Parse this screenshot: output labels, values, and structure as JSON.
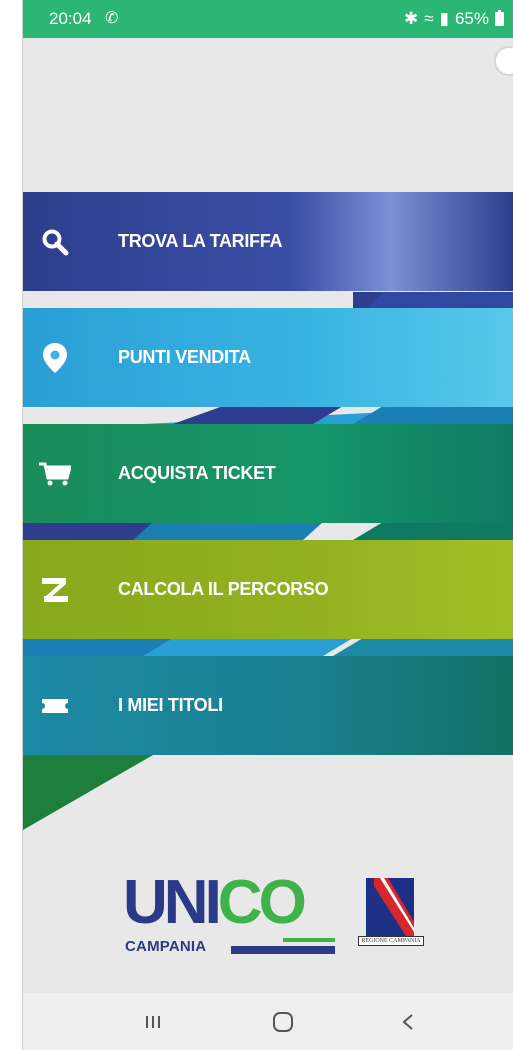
{
  "status_bar": {
    "time": "20:04",
    "call_icon": "call-icon",
    "signal_text": "65%",
    "bg_color": "#2bb673"
  },
  "menu": {
    "items": [
      {
        "label": "TROVA LA TARIFFA",
        "icon": "search-icon",
        "color": "#2e3d8d"
      },
      {
        "label": "PUNTI VENDITA",
        "icon": "location-pin-icon",
        "color": "#39b5e2"
      },
      {
        "label": "ACQUISTA TICKET",
        "icon": "cart-icon",
        "color": "#15956a"
      },
      {
        "label": "CALCOLA IL PERCORSO",
        "icon": "route-icon",
        "color": "#92b221"
      },
      {
        "label": "I MIEI TITOLI",
        "icon": "ticket-icon",
        "color": "#1a7f8e"
      }
    ]
  },
  "logos": {
    "unico": {
      "un": "UN",
      "i": "I",
      "co": "CO",
      "sub": "CAMPANIA"
    },
    "regione": {
      "text": "REGIONE CAMPANIA"
    }
  },
  "nav": {
    "recents_icon": "recents-icon",
    "home_icon": "home-icon",
    "back_icon": "back-icon"
  }
}
